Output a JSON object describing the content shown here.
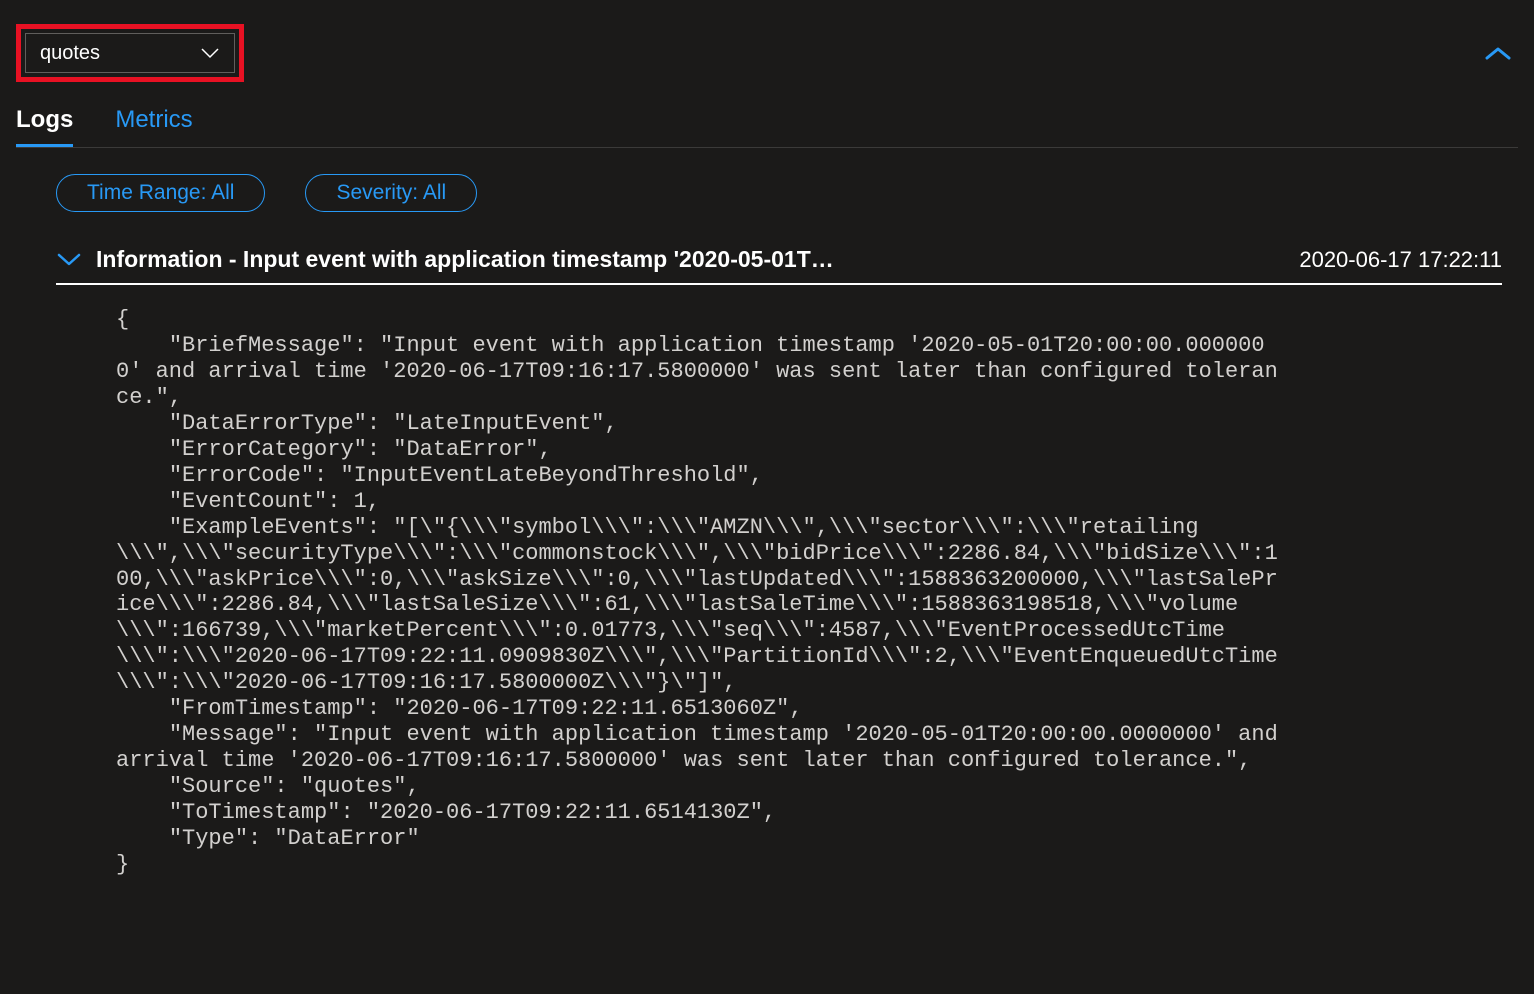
{
  "dropdown": {
    "selected": "quotes"
  },
  "tabs": {
    "logs": "Logs",
    "metrics": "Metrics"
  },
  "filters": {
    "time_range": "Time Range: All",
    "severity": "Severity: All"
  },
  "log": {
    "title": "Information - Input event with application timestamp '2020-05-01T…",
    "timestamp": "2020-06-17 17:22:11",
    "body": "{\n    \"BriefMessage\": \"Input event with application timestamp '2020-05-01T20:00:00.0000000' and arrival time '2020-06-17T09:16:17.5800000' was sent later than configured tolerance.\",\n    \"DataErrorType\": \"LateInputEvent\",\n    \"ErrorCategory\": \"DataError\",\n    \"ErrorCode\": \"InputEventLateBeyondThreshold\",\n    \"EventCount\": 1,\n    \"ExampleEvents\": \"[\\\"{\\\\\\\"symbol\\\\\\\":\\\\\\\"AMZN\\\\\\\",\\\\\\\"sector\\\\\\\":\\\\\\\"retailing\\\\\\\",\\\\\\\"securityType\\\\\\\":\\\\\\\"commonstock\\\\\\\",\\\\\\\"bidPrice\\\\\\\":2286.84,\\\\\\\"bidSize\\\\\\\":100,\\\\\\\"askPrice\\\\\\\":0,\\\\\\\"askSize\\\\\\\":0,\\\\\\\"lastUpdated\\\\\\\":1588363200000,\\\\\\\"lastSalePrice\\\\\\\":2286.84,\\\\\\\"lastSaleSize\\\\\\\":61,\\\\\\\"lastSaleTime\\\\\\\":1588363198518,\\\\\\\"volume\\\\\\\":166739,\\\\\\\"marketPercent\\\\\\\":0.01773,\\\\\\\"seq\\\\\\\":4587,\\\\\\\"EventProcessedUtcTime\\\\\\\":\\\\\\\"2020-06-17T09:22:11.0909830Z\\\\\\\",\\\\\\\"PartitionId\\\\\\\":2,\\\\\\\"EventEnqueuedUtcTime\\\\\\\":\\\\\\\"2020-06-17T09:16:17.5800000Z\\\\\\\"}\\\"]\",\n    \"FromTimestamp\": \"2020-06-17T09:22:11.6513060Z\",\n    \"Message\": \"Input event with application timestamp '2020-05-01T20:00:00.0000000' and arrival time '2020-06-17T09:16:17.5800000' was sent later than configured tolerance.\",\n    \"Source\": \"quotes\",\n    \"ToTimestamp\": \"2020-06-17T09:22:11.6514130Z\",\n    \"Type\": \"DataError\"\n}"
  }
}
